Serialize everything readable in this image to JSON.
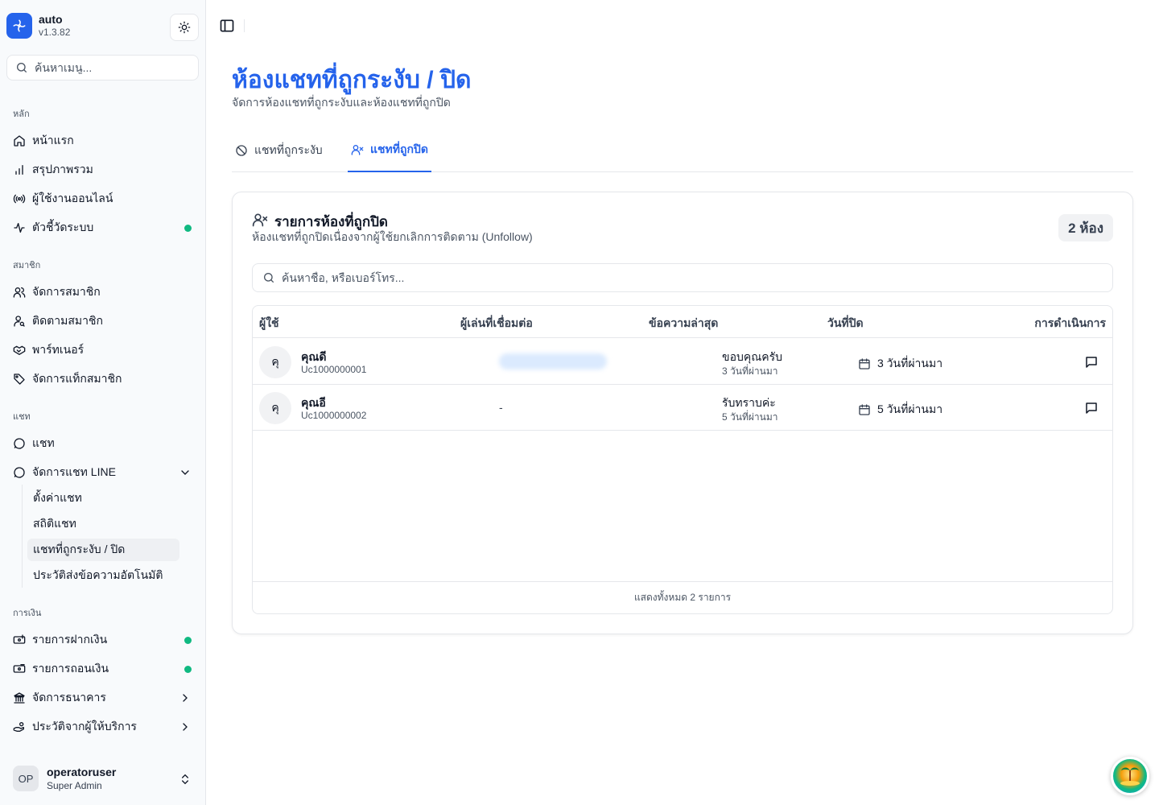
{
  "app": {
    "name": "auto",
    "version": "v1.3.82"
  },
  "sidebar": {
    "search_placeholder": "ค้นหาเมนู...",
    "sections": [
      {
        "label": "หลัก",
        "items": [
          {
            "label": "หน้าแรก",
            "icon": "home-icon"
          },
          {
            "label": "สรุปภาพรวม",
            "icon": "bar-chart-icon"
          },
          {
            "label": "ผู้ใช้งานออนไลน์",
            "icon": "radio-icon"
          },
          {
            "label": "ตัวชี้วัดระบบ",
            "icon": "activity-icon",
            "status_dot": "#10b981"
          }
        ]
      },
      {
        "label": "สมาชิก",
        "items": [
          {
            "label": "จัดการสมาชิก",
            "icon": "users-icon"
          },
          {
            "label": "ติดตามสมาชิก",
            "icon": "user-search-icon"
          },
          {
            "label": "พาร์ทเนอร์",
            "icon": "handshake-icon"
          },
          {
            "label": "จัดการแท็กสมาชิก",
            "icon": "tag-icon"
          }
        ]
      },
      {
        "label": "แชท",
        "items": [
          {
            "label": "แชท",
            "icon": "message-circle-icon"
          },
          {
            "label": "จัดการแชท LINE",
            "icon": "message-circle-icon",
            "expanded": true,
            "children": [
              {
                "label": "ตั้งค่าแชท"
              },
              {
                "label": "สถิติแชท"
              },
              {
                "label": "แชทที่ถูกระงับ / ปิด",
                "active": true
              },
              {
                "label": "ประวัติส่งข้อความอัตโนมัติ"
              }
            ]
          }
        ]
      },
      {
        "label": "การเงิน",
        "items": [
          {
            "label": "รายการฝากเงิน",
            "icon": "deposit-icon",
            "status_dot": "#10b981"
          },
          {
            "label": "รายการถอนเงิน",
            "icon": "withdraw-icon",
            "status_dot": "#10b981"
          },
          {
            "label": "จัดการธนาคาร",
            "icon": "bank-icon"
          },
          {
            "label": "ประวัติจากผู้ให้บริการ",
            "icon": "hand-coins-icon"
          }
        ]
      }
    ],
    "user": {
      "initials": "OP",
      "name": "operatoruser",
      "role": "Super Admin"
    }
  },
  "page": {
    "title": "ห้องแชทที่ถูกระงับ / ปิด",
    "subtitle": "จัดการห้องแชทที่ถูกระงับและห้องแชทที่ถูกปิด",
    "tabs": [
      {
        "label": "แชทที่ถูกระงับ",
        "icon": "ban-icon",
        "active": false
      },
      {
        "label": "แชทที่ถูกปิด",
        "icon": "user-x-icon",
        "active": true
      }
    ]
  },
  "card": {
    "title": "รายการห้องที่ถูกปิด",
    "description": "ห้องแชทที่ถูกปิดเนื่องจากผู้ใช้ยกเลิกการติดตาม (Unfollow)",
    "count_badge": "2 ห้อง",
    "search_placeholder": "ค้นหาชื่อ, หรือเบอร์โทร...",
    "columns": [
      "ผู้ใช้",
      "ผู้เล่นที่เชื่อมต่อ",
      "ข้อความล่าสุด",
      "วันที่ปิด",
      "การดำเนินการ"
    ],
    "rows": [
      {
        "avatar": "คุ",
        "name": "คุณดี",
        "uid": "Uc1000000001",
        "linked_player": "",
        "linked_player_blurred": true,
        "last_message": "ขอบคุณครับ",
        "last_message_ago": "3 วันที่ผ่านมา",
        "closed": "3 วันที่ผ่านมา"
      },
      {
        "avatar": "คุ",
        "name": "คุณอี",
        "uid": "Uc1000000002",
        "linked_player": "-",
        "linked_player_blurred": false,
        "last_message": "รับทราบค่ะ",
        "last_message_ago": "5 วันที่ผ่านมา",
        "closed": "5 วันที่ผ่านมา"
      }
    ],
    "footer": "แสดงทั้งหมด 2 รายการ"
  },
  "colors": {
    "accent": "#2563eb",
    "status_online": "#10b981"
  }
}
